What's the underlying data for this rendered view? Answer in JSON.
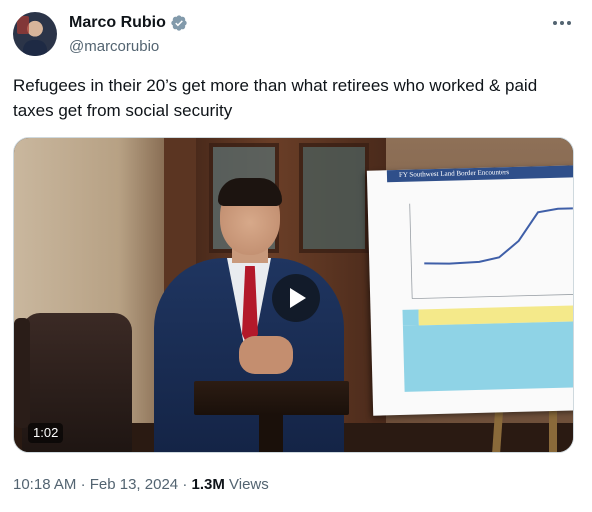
{
  "author": {
    "display_name": "Marco Rubio",
    "handle": "@marcorubio",
    "verified": true
  },
  "tweet": {
    "text": "Refugees in their 20’s get more than what retirees who worked & paid taxes get from social security"
  },
  "media": {
    "type": "video",
    "duration": "1:02",
    "poster_title": "FY Southwest Land Border Encounters"
  },
  "meta": {
    "time": "10:18 AM",
    "separator": "·",
    "date": "Feb 13, 2024",
    "views_count": "1.3M",
    "views_label": "Views"
  },
  "colors": {
    "accent": "#1d9bf0",
    "text_primary": "#0f1419",
    "text_secondary": "#536471"
  },
  "icons": {
    "verified": "verified-badge-icon",
    "more": "more-horizontal-icon",
    "play": "play-icon"
  }
}
